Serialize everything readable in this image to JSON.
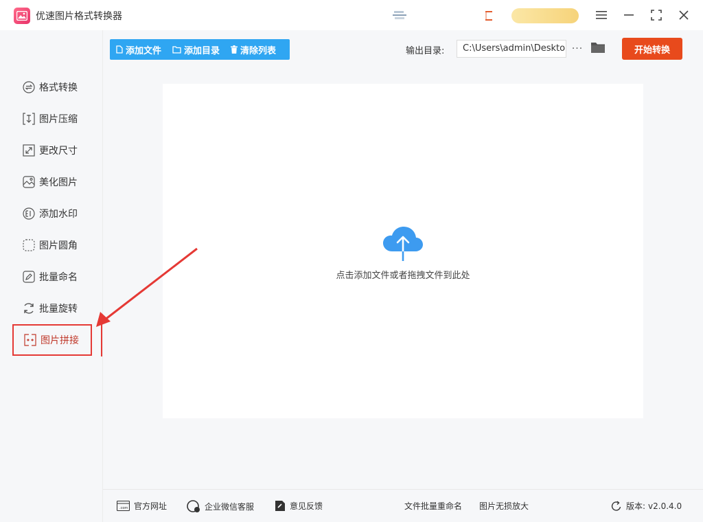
{
  "app": {
    "title": "优速图片格式转换器",
    "icons": {
      "logo": "picture-logo-icon",
      "menu": "hamburger-icon",
      "minimize": "minimize-icon",
      "maximize": "maximize-icon",
      "close": "close-icon"
    }
  },
  "toolbar": {
    "add_file_label": "添加文件",
    "add_folder_label": "添加目录",
    "clear_list_label": "清除列表",
    "output_label": "输出目录:",
    "output_path": "C:\\Users\\admin\\Deskto",
    "more_label": "···",
    "start_label": "开始转换"
  },
  "sidebar": {
    "items": [
      {
        "label": "格式转换",
        "icon": "swap-circle-icon",
        "active": false
      },
      {
        "label": "图片压缩",
        "icon": "compress-icon",
        "active": false
      },
      {
        "label": "更改尺寸",
        "icon": "resize-icon",
        "active": false
      },
      {
        "label": "美化图片",
        "icon": "beautify-icon",
        "active": false
      },
      {
        "label": "添加水印",
        "icon": "watermark-icon",
        "active": false
      },
      {
        "label": "图片圆角",
        "icon": "rounded-corner-icon",
        "active": false
      },
      {
        "label": "批量命名",
        "icon": "rename-icon",
        "active": false
      },
      {
        "label": "批量旋转",
        "icon": "rotate-icon",
        "active": false
      },
      {
        "label": "图片拼接",
        "icon": "stitch-icon",
        "active": true
      }
    ]
  },
  "main": {
    "drop_text": "点击添加文件或者拖拽文件到此处"
  },
  "footer": {
    "site_label": "官方网址",
    "wechat_label": "企业微信客服",
    "feedback_label": "意见反馈",
    "rename_link": "文件批量重命名",
    "enlarge_link": "图片无损放大",
    "version_label": "版本:",
    "version_value": "v2.0.4.0"
  },
  "colors": {
    "accent_blue": "#2fa6f2",
    "start_orange": "#e84a1c",
    "annotation_red": "#e53935"
  }
}
